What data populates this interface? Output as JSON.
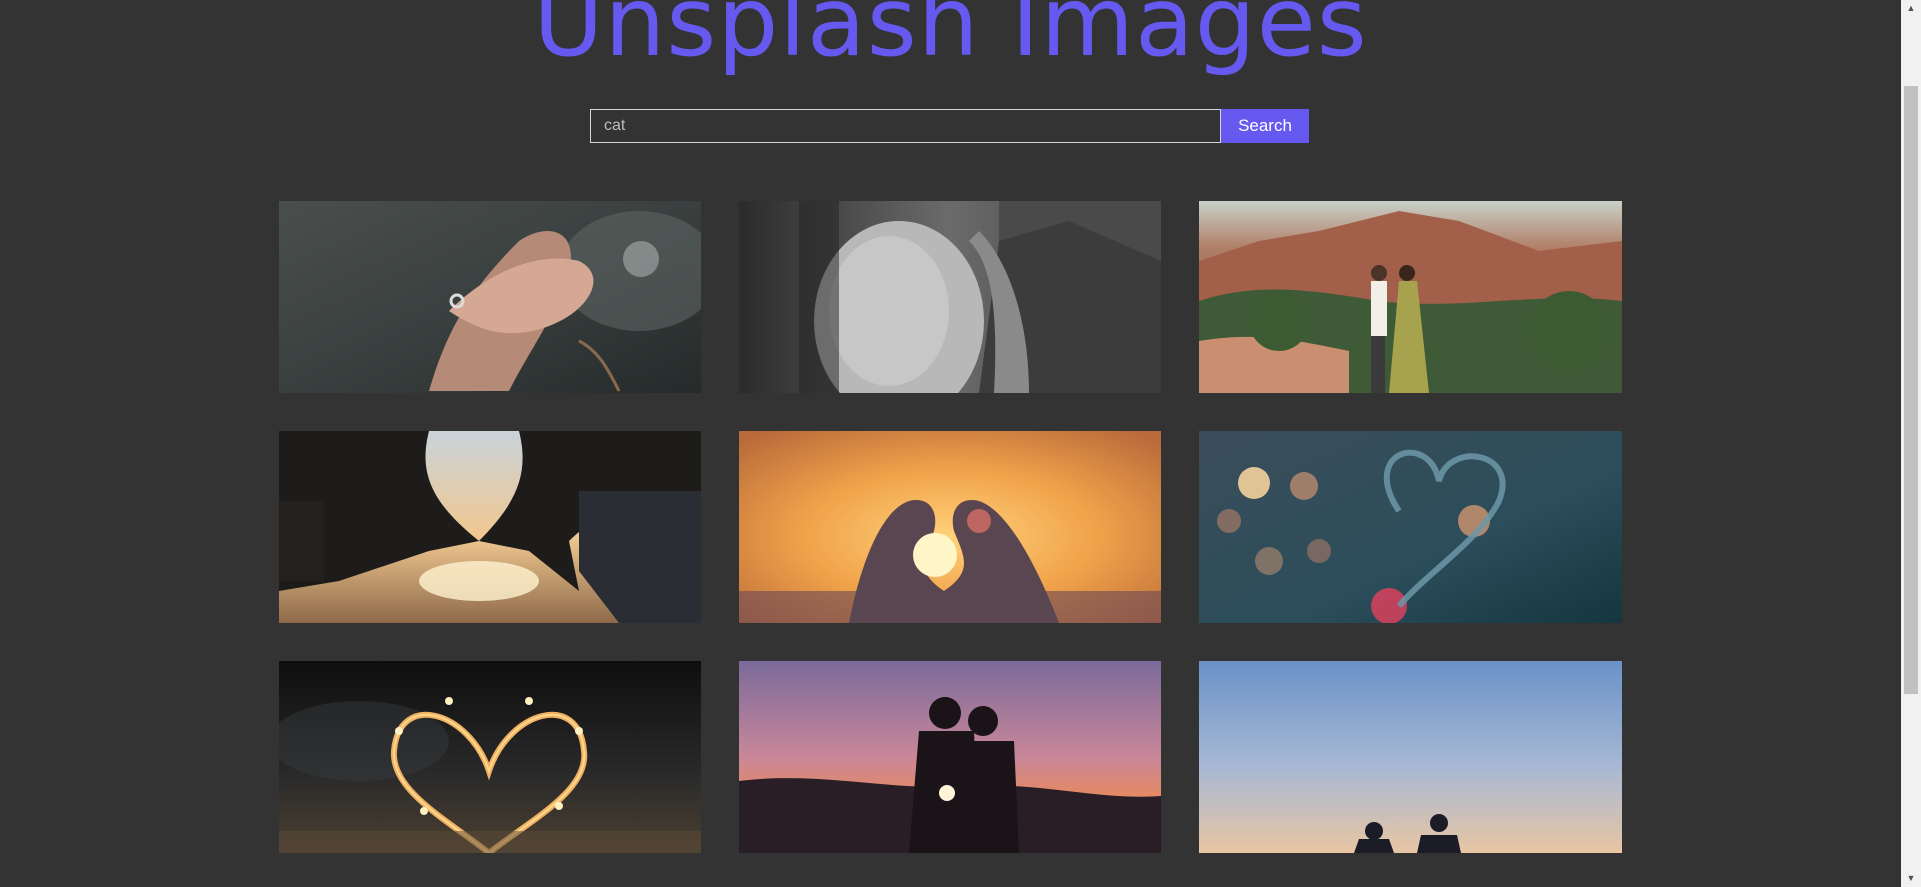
{
  "header": {
    "title": "Unsplash Images"
  },
  "search": {
    "value": "cat",
    "button_label": "Search"
  },
  "gallery": {
    "images": [
      {
        "name": "image-hands-ring"
      },
      {
        "name": "image-elderly-couple-bw"
      },
      {
        "name": "image-couple-red-rocks"
      },
      {
        "name": "image-heart-hands-beach-sunset"
      },
      {
        "name": "image-heart-hands-orange-sun"
      },
      {
        "name": "image-heart-drawn-on-glass"
      },
      {
        "name": "image-heart-string-lights"
      },
      {
        "name": "image-couple-silhouette-sunset"
      },
      {
        "name": "image-couple-blue-sky"
      }
    ]
  },
  "colors": {
    "accent": "#6559f0",
    "background": "#333333"
  },
  "icons": {
    "scroll_up": "triangle-up-icon",
    "scroll_down": "triangle-down-icon"
  }
}
